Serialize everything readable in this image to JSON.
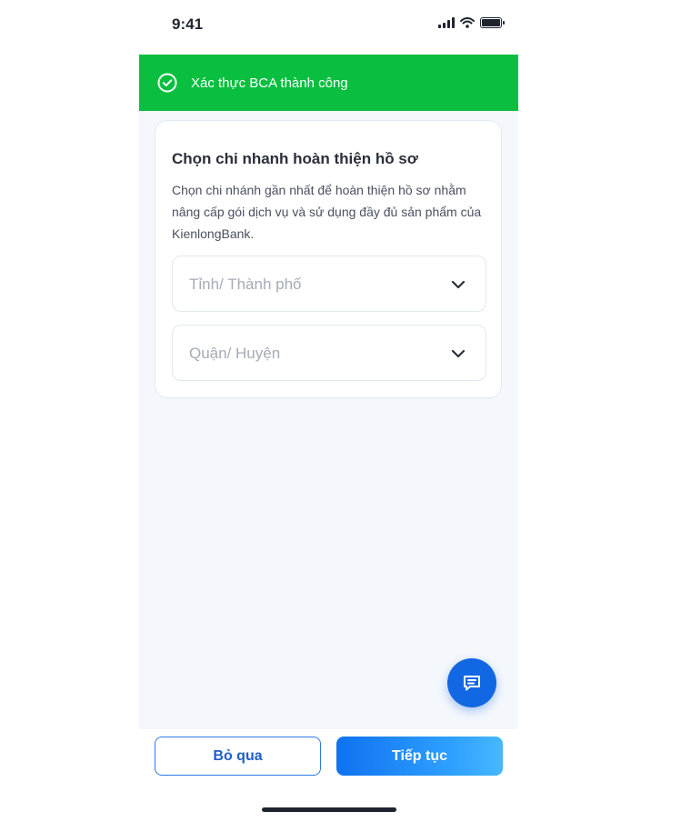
{
  "status_bar": {
    "time": "9:41"
  },
  "banner": {
    "text": "Xác thực BCA thành công",
    "color": "#0abf40",
    "icon": "check-circle-icon"
  },
  "card": {
    "title": "Chọn chi nhanh hoàn thiện hồ sơ",
    "description": "Chọn chi nhánh gần nhất để hoàn thiện hồ sơ nhằm nâng cấp gói dịch vụ và sử dụng đầy đủ sản phẩm của KienlongBank.",
    "city_select": {
      "placeholder": "Tỉnh/ Thành phố",
      "icon": "chevron-down-icon"
    },
    "district_select": {
      "placeholder": "Quận/ Huyện",
      "icon": "chevron-down-icon"
    }
  },
  "chat_button": {
    "icon": "chat-icon",
    "color": "#1268e3"
  },
  "footer": {
    "skip_label": "Bỏ qua",
    "next_label": "Tiếp tục"
  }
}
